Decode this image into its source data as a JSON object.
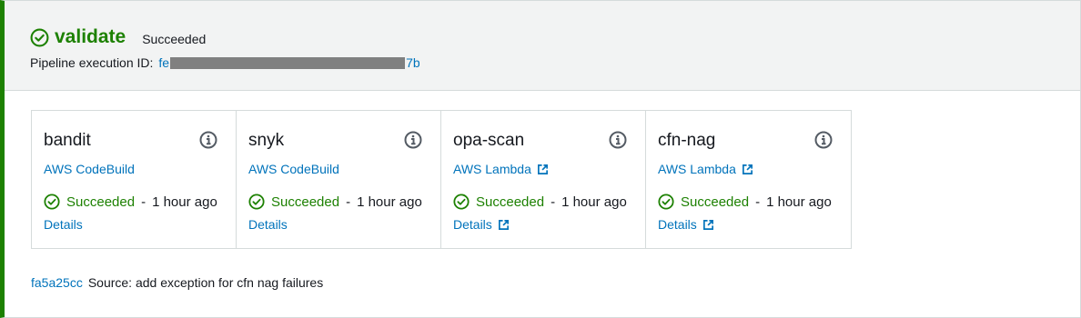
{
  "stage": {
    "name": "validate",
    "status": "Succeeded",
    "execution_label": "Pipeline execution ID:",
    "execution_id_start": "fe",
    "execution_id_end": "7b"
  },
  "actions": [
    {
      "name": "bandit",
      "provider": "AWS CodeBuild",
      "provider_external": false,
      "status": "Succeeded",
      "separator": "-",
      "time": "1 hour ago",
      "details": "Details",
      "details_external": false
    },
    {
      "name": "snyk",
      "provider": "AWS CodeBuild",
      "provider_external": false,
      "status": "Succeeded",
      "separator": "-",
      "time": "1 hour ago",
      "details": "Details",
      "details_external": false
    },
    {
      "name": "opa-scan",
      "provider": "AWS Lambda",
      "provider_external": true,
      "status": "Succeeded",
      "separator": "-",
      "time": "1 hour ago",
      "details": "Details",
      "details_external": true
    },
    {
      "name": "cfn-nag",
      "provider": "AWS Lambda",
      "provider_external": true,
      "status": "Succeeded",
      "separator": "-",
      "time": "1 hour ago",
      "details": "Details",
      "details_external": true
    }
  ],
  "source": {
    "commit_id": "fa5a25cc",
    "message": "Source: add exception for cfn nag failures"
  },
  "icons": {
    "status": "check-circle-icon",
    "info": "info-icon",
    "external": "external-link-icon"
  },
  "colors": {
    "success": "#1d8102",
    "link": "#0073bb",
    "header_bg": "#f2f3f3",
    "border": "#d5dbdb"
  }
}
